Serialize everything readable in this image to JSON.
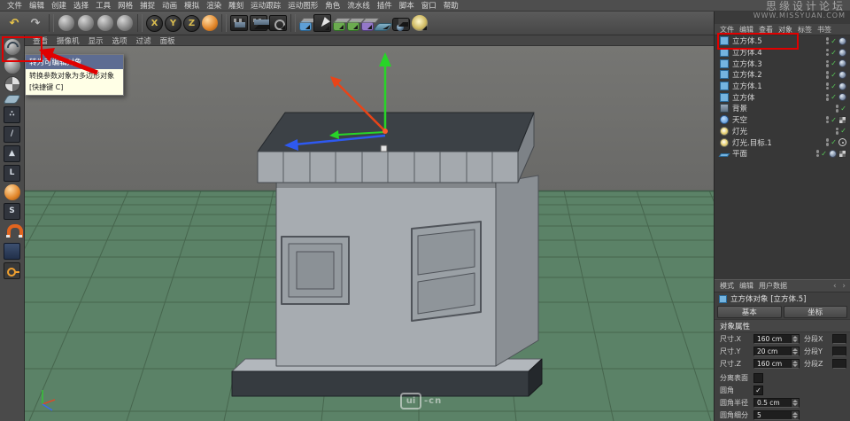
{
  "app": {
    "background_color": "#454545",
    "annotation_color": "#e10000"
  },
  "watermark": {
    "site_name": "思缘设计论坛",
    "site_url": "WWW.MISSYUAN.COM",
    "logo_text": "ui",
    "logo_suffix": "-cn"
  },
  "menu_bar": {
    "items": [
      "文件",
      "编辑",
      "创建",
      "选择",
      "工具",
      "网格",
      "捕捉",
      "动画",
      "模拟",
      "渲染",
      "雕刻",
      "运动跟踪",
      "运动图形",
      "角色",
      "流水线",
      "插件",
      "脚本",
      "窗口",
      "帮助"
    ]
  },
  "toolbar": {
    "icons": [
      {
        "name": "undo-icon",
        "type": "glyph",
        "glyph": "↶",
        "color": "#e8c44a"
      },
      {
        "name": "redo-icon",
        "type": "glyph",
        "glyph": "↷",
        "color": "#bdbdbd"
      },
      {
        "name": "toolbar-separator",
        "type": "sep"
      },
      {
        "name": "live-selection-icon",
        "type": "sphere"
      },
      {
        "name": "move-tool-icon",
        "type": "sphere"
      },
      {
        "name": "scale-tool-icon",
        "type": "sphere"
      },
      {
        "name": "rotate-tool-icon",
        "type": "sphere"
      },
      {
        "name": "toolbar-separator",
        "type": "sep"
      },
      {
        "name": "lock-x-axis-icon",
        "type": "axis",
        "glyph": "X"
      },
      {
        "name": "lock-y-axis-icon",
        "type": "axis",
        "glyph": "Y"
      },
      {
        "name": "lock-z-axis-icon",
        "type": "axis",
        "glyph": "Z"
      },
      {
        "name": "coordinate-system-icon",
        "type": "orange-ball"
      },
      {
        "name": "toolbar-separator",
        "type": "sep"
      },
      {
        "name": "render-view-icon",
        "type": "render"
      },
      {
        "name": "render-picture-viewer-icon",
        "type": "render",
        "dropdown": true
      },
      {
        "name": "render-settings-icon",
        "type": "render-gear",
        "dropdown": true
      },
      {
        "name": "toolbar-separator",
        "type": "sep"
      },
      {
        "name": "add-primitive-cube-icon",
        "type": "cube-blue",
        "dropdown": true
      },
      {
        "name": "add-spline-icon",
        "type": "pen",
        "dropdown": true
      },
      {
        "name": "add-subdivision-surface-icon",
        "type": "cube-green",
        "dropdown": true
      },
      {
        "name": "add-array-icon",
        "type": "cube-green",
        "dropdown": true
      },
      {
        "name": "add-deformer-icon",
        "type": "cube-purple",
        "dropdown": true
      },
      {
        "name": "add-floor-icon",
        "type": "floor",
        "dropdown": true
      },
      {
        "name": "add-camera-icon",
        "type": "camera",
        "dropdown": true
      },
      {
        "name": "add-light-icon",
        "type": "light",
        "dropdown": true
      }
    ]
  },
  "left_toolbar": {
    "icons": [
      {
        "name": "make-editable-icon",
        "type": "sphere-arrows"
      },
      {
        "name": "model-mode-icon",
        "type": "sphere"
      },
      {
        "name": "texture-mode-icon",
        "type": "sphere-checker"
      },
      {
        "name": "workplane-mode-icon",
        "type": "plane-flat"
      },
      {
        "name": "points-mode-icon",
        "type": "dark",
        "glyph": "∴"
      },
      {
        "name": "edges-mode-icon",
        "type": "dark",
        "glyph": "/"
      },
      {
        "name": "polygons-mode-icon",
        "type": "dark",
        "glyph": "▲"
      },
      {
        "name": "axis-mode-icon",
        "type": "dark",
        "glyph": "L"
      },
      {
        "name": "texture-axis-mode-icon",
        "type": "orange-ball"
      },
      {
        "name": "snap-settings-icon",
        "type": "dark",
        "glyph": "S"
      },
      {
        "name": "magnet-snap-icon",
        "type": "magnet"
      },
      {
        "name": "workplane-lock-icon",
        "type": "dark-blue"
      },
      {
        "name": "auto-key-icon",
        "type": "orange-key"
      }
    ]
  },
  "viewport": {
    "menu_items": [
      "查看",
      "摄像机",
      "显示",
      "选项",
      "过滤",
      "面板"
    ],
    "tooltip": {
      "title": "转为可编辑对象",
      "description": "转换参数对象为多边形对象",
      "shortcut": "[快捷键 C]"
    }
  },
  "object_manager": {
    "menu_items": [
      "文件",
      "编辑",
      "查看",
      "对象",
      "标签",
      "书签"
    ],
    "objects": [
      {
        "name": "立方体.5",
        "icon": "cube",
        "highlighted": true,
        "tags": [
          "phong"
        ]
      },
      {
        "name": "立方体.4",
        "icon": "cube",
        "tags": [
          "phong"
        ]
      },
      {
        "name": "立方体.3",
        "icon": "cube",
        "tags": [
          "phong"
        ]
      },
      {
        "name": "立方体.2",
        "icon": "cube",
        "tags": [
          "phong"
        ]
      },
      {
        "name": "立方体.1",
        "icon": "cube",
        "tags": [
          "phong"
        ]
      },
      {
        "name": "立方体",
        "icon": "cube",
        "tags": [
          "phong"
        ]
      },
      {
        "name": "背景",
        "icon": "background",
        "tags": []
      },
      {
        "name": "天空",
        "icon": "sky",
        "tags": [
          "texture"
        ]
      },
      {
        "name": "灯光",
        "icon": "light",
        "tags": []
      },
      {
        "name": "灯光.目标.1",
        "icon": "light",
        "tags": [
          "target"
        ]
      },
      {
        "name": "平面",
        "icon": "plane",
        "tags": [
          "phong",
          "texture"
        ]
      }
    ]
  },
  "attribute_manager": {
    "menu_items": [
      "模式",
      "编辑",
      "用户数据"
    ],
    "title": "立方体对象 [立方体.5]",
    "tabs": [
      "基本",
      "坐标"
    ],
    "section": "对象属性",
    "dimension_rows": [
      {
        "label": "尺寸.X",
        "value": "160 cm",
        "seg_label": "分段X"
      },
      {
        "label": "尺寸.Y",
        "value": "20 cm",
        "seg_label": "分段Y"
      },
      {
        "label": "尺寸.Z",
        "value": "160 cm",
        "seg_label": "分段Z"
      }
    ],
    "options": [
      {
        "label": "分离表面",
        "checked": false
      },
      {
        "label": "圆角",
        "checked": true
      }
    ],
    "fillet_rows": [
      {
        "label": "圆角半径",
        "value": "0.5 cm"
      },
      {
        "label": "圆角细分",
        "value": "5"
      }
    ]
  }
}
